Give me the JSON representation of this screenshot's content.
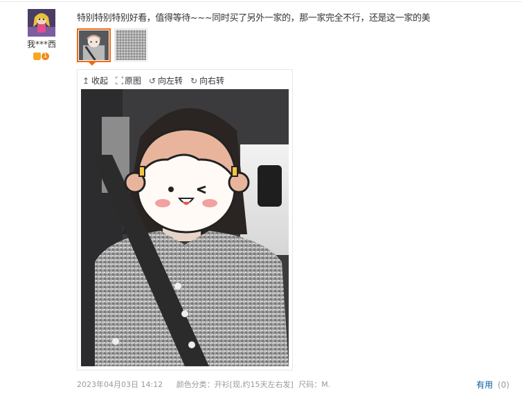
{
  "user": {
    "name": "我***西",
    "level": "1"
  },
  "comment": {
    "text": "特别特别特别好看，值得等待~~~同时买了另外一家的，那一家完全不行，还是这一家的美"
  },
  "viewer": {
    "tools": [
      {
        "label": "收起",
        "icon": "arrow-up-icon"
      },
      {
        "label": "原图",
        "icon": "expand-icon"
      },
      {
        "label": "向左转",
        "icon": "rotate-left-icon"
      },
      {
        "label": "向右转",
        "icon": "rotate-right-icon"
      }
    ]
  },
  "meta": {
    "date": "2023年04月03日 14:12",
    "color_category": "颜色分类：开衫[现,约15天左右发]",
    "size": "尺码：M."
  },
  "useful": {
    "label": "有用",
    "count": "(0)"
  },
  "colors": {
    "accent": "#f26a10",
    "link": "#005aa0",
    "meta_text": "#999999"
  }
}
